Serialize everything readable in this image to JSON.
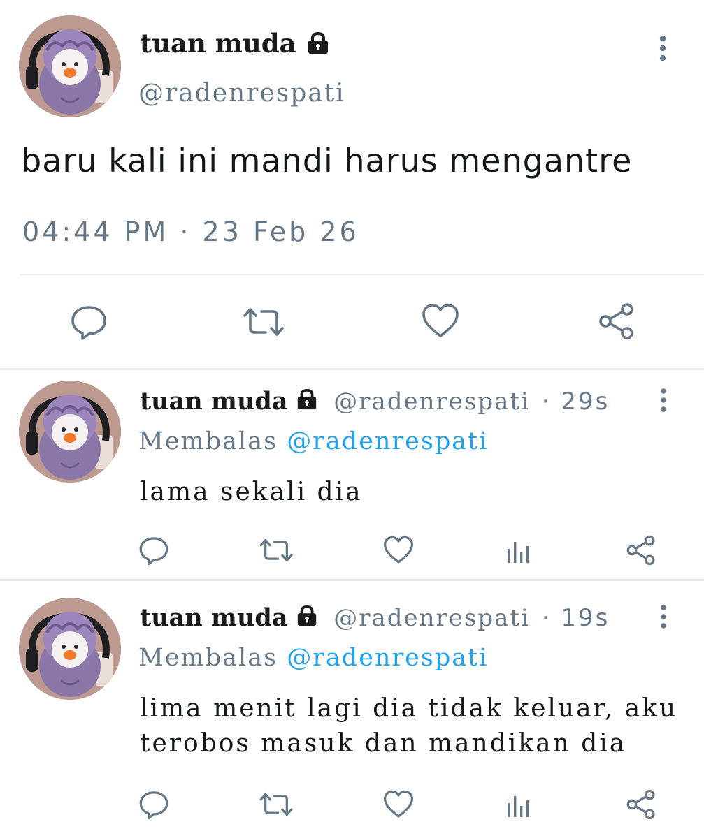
{
  "main_tweet": {
    "display_name": "tuan muda",
    "handle": "@radenrespati",
    "text": "baru kali ini mandi harus mengantre",
    "timestamp": "04:44 PM · 23 Feb 26",
    "icons": {
      "lock": "lock-icon",
      "more": "more-vertical-icon",
      "reply": "reply-icon",
      "retweet": "retweet-icon",
      "like": "heart-icon",
      "share": "share-icon"
    }
  },
  "replies": [
    {
      "display_name": "tuan muda",
      "handle": "@radenrespati",
      "time": "· 29s",
      "replying_label": "Membalas",
      "replying_to": "@radenrespati",
      "text": "lama sekali dia"
    },
    {
      "display_name": "tuan muda",
      "handle": "@radenrespati",
      "time": "· 19s",
      "replying_label": "Membalas",
      "replying_to": "@radenrespati",
      "text": "lima menit lagi dia tidak keluar, aku terobos masuk dan mandikan dia"
    }
  ],
  "colors": {
    "text_primary": "#14171a",
    "text_secondary": "#657786",
    "accent": "#1da1f2",
    "icon": "#657786",
    "divider": "#e6ecf0"
  }
}
